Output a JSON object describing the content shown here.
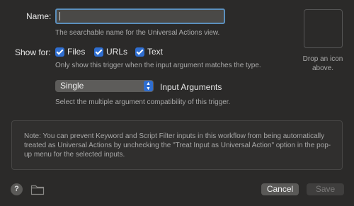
{
  "name_field": {
    "label": "Name:",
    "value": "",
    "hint": "The searchable name for the Universal Actions view."
  },
  "show_for": {
    "label": "Show for:",
    "options": [
      {
        "label": "Files",
        "checked": true
      },
      {
        "label": "URLs",
        "checked": true
      },
      {
        "label": "Text",
        "checked": true
      }
    ],
    "hint": "Only show this trigger when the input argument matches the type."
  },
  "arguments": {
    "selected": "Single",
    "label": "Input Arguments",
    "hint": "Select the multiple argument compatibility of this trigger."
  },
  "icon_well": {
    "hint": "Drop an icon above."
  },
  "note": "Note: You can prevent Keyword and Script Filter inputs in this workflow from being automatically treated as Universal Actions by unchecking the \"Treat Input as Universal Action\" option in the pop-up menu for the selected inputs.",
  "footer": {
    "help_label": "?",
    "cancel_label": "Cancel",
    "save_label": "Save"
  },
  "colors": {
    "accent": "#2f6ed0",
    "focus_ring": "#5b8fbd",
    "background": "#2b2a29"
  },
  "icons": {
    "help": "help-icon",
    "folder": "folder-icon",
    "checkbox": "check-icon",
    "stepper": "chevron-up-down-icon"
  }
}
